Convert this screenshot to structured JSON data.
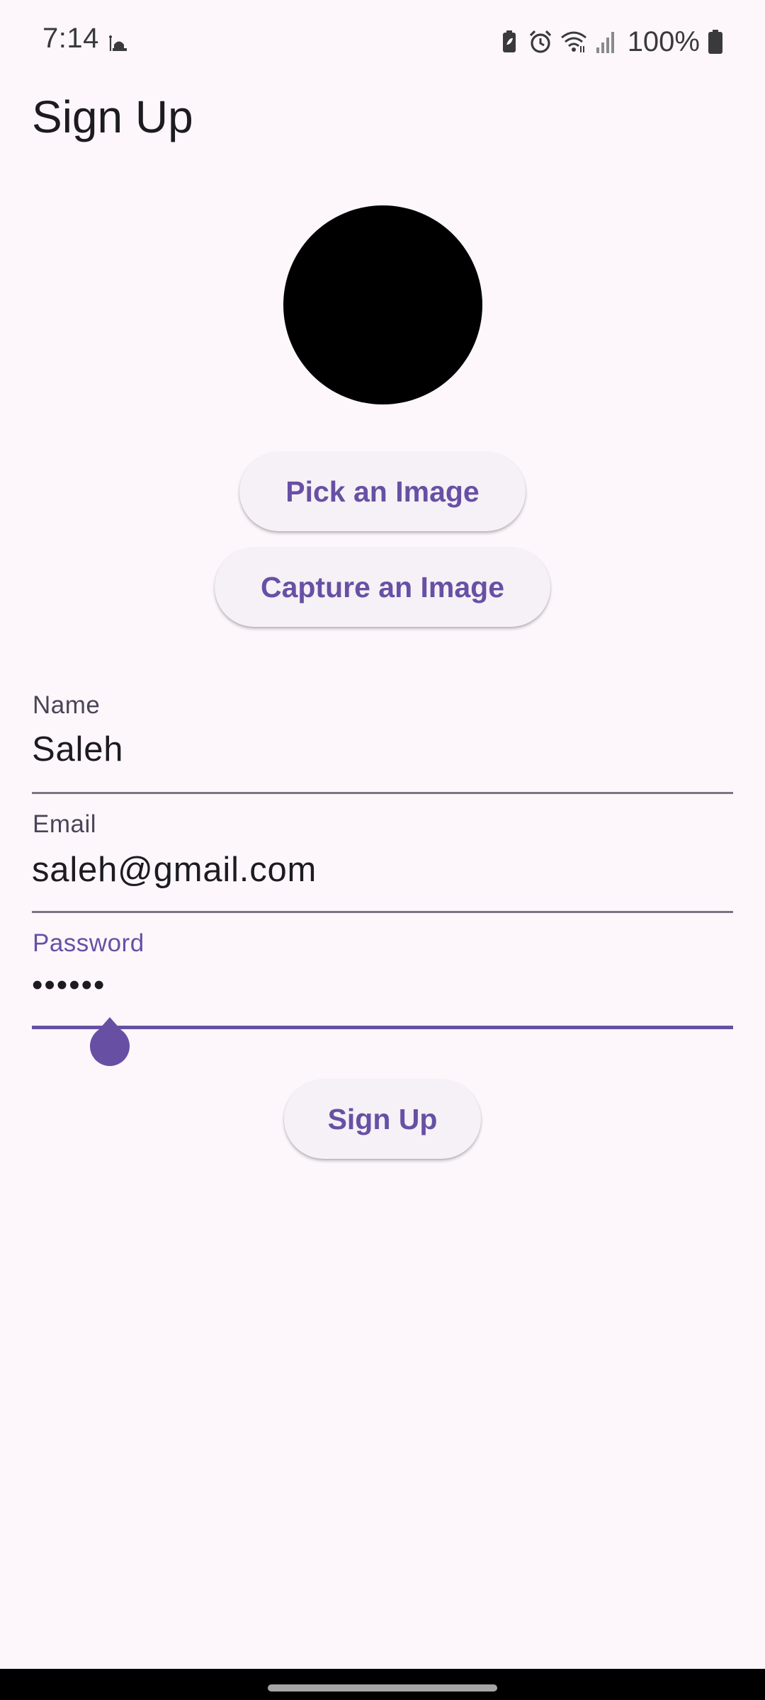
{
  "status_bar": {
    "time": "7:14",
    "battery_percent": "100%",
    "icons": [
      "mosque-icon",
      "battery-saver-icon",
      "alarm-icon",
      "wifi-icon",
      "signal-icon",
      "battery-icon"
    ]
  },
  "app_bar": {
    "title": "Sign Up"
  },
  "avatar": {
    "icon": "profile-image-placeholder",
    "color": "#000000"
  },
  "actions": {
    "pick_image_label": "Pick an Image",
    "capture_image_label": "Capture an Image",
    "sign_up_label": "Sign Up"
  },
  "form": {
    "name": {
      "label": "Name",
      "value": "Saleh"
    },
    "email": {
      "label": "Email",
      "value": "saleh@gmail.com"
    },
    "password": {
      "label": "Password",
      "value": "••••••",
      "focused": true
    }
  },
  "colors": {
    "primary": "#6750a4",
    "background": "#fdf7fc",
    "button_surface": "#f5f1f6"
  }
}
